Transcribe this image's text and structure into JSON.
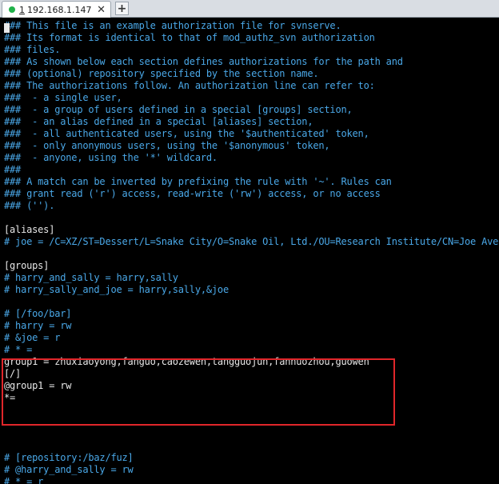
{
  "tab": {
    "index": "1",
    "title": "192.168.1.147",
    "close_glyph": "✕",
    "add_glyph": "+"
  },
  "lines": [
    {
      "kind": "comment",
      "text": "### This file is an example authorization file for svnserve."
    },
    {
      "kind": "comment",
      "text": "### Its format is identical to that of mod_authz_svn authorization"
    },
    {
      "kind": "comment",
      "text": "### files."
    },
    {
      "kind": "comment",
      "text": "### As shown below each section defines authorizations for the path and"
    },
    {
      "kind": "comment",
      "text": "### (optional) repository specified by the section name."
    },
    {
      "kind": "comment",
      "text": "### The authorizations follow. An authorization line can refer to:"
    },
    {
      "kind": "comment",
      "text": "###  - a single user,"
    },
    {
      "kind": "comment",
      "text": "###  - a group of users defined in a special [groups] section,"
    },
    {
      "kind": "comment",
      "text": "###  - an alias defined in a special [aliases] section,"
    },
    {
      "kind": "comment",
      "text": "###  - all authenticated users, using the '$authenticated' token,"
    },
    {
      "kind": "comment",
      "text": "###  - only anonymous users, using the '$anonymous' token,"
    },
    {
      "kind": "comment",
      "text": "###  - anyone, using the '*' wildcard."
    },
    {
      "kind": "comment",
      "text": "###"
    },
    {
      "kind": "comment",
      "text": "### A match can be inverted by prefixing the rule with '~'. Rules can"
    },
    {
      "kind": "comment",
      "text": "### grant read ('r') access, read-write ('rw') access, or no access"
    },
    {
      "kind": "comment",
      "text": "### ('')."
    },
    {
      "kind": "plain",
      "text": ""
    },
    {
      "kind": "plain",
      "text": "[aliases]"
    },
    {
      "kind": "comment",
      "text": "# joe = /C=XZ/ST=Dessert/L=Snake City/O=Snake Oil, Ltd./OU=Research Institute/CN=Joe Ave"
    },
    {
      "kind": "plain",
      "text": ""
    },
    {
      "kind": "plain",
      "text": "[groups]"
    },
    {
      "kind": "comment",
      "text": "# harry_and_sally = harry,sally"
    },
    {
      "kind": "comment",
      "text": "# harry_sally_and_joe = harry,sally,&joe"
    },
    {
      "kind": "plain",
      "text": ""
    },
    {
      "kind": "comment",
      "text": "# [/foo/bar]"
    },
    {
      "kind": "comment",
      "text": "# harry = rw"
    },
    {
      "kind": "comment",
      "text": "# &joe = r"
    },
    {
      "kind": "comment",
      "text": "# * ="
    },
    {
      "kind": "plain",
      "text": "group1 = zhuxiaoyong,fanguo,caozewen,tangguojun,fannuozhou,guowen"
    },
    {
      "kind": "plain",
      "text": "[/]"
    },
    {
      "kind": "plain",
      "text": "@group1 = rw"
    },
    {
      "kind": "plain",
      "text": "*="
    },
    {
      "kind": "plain",
      "text": ""
    },
    {
      "kind": "plain",
      "text": ""
    },
    {
      "kind": "plain",
      "text": ""
    },
    {
      "kind": "plain",
      "text": ""
    },
    {
      "kind": "comment",
      "text": "# [repository:/baz/fuz]"
    },
    {
      "kind": "comment",
      "text": "# @harry_and_sally = rw"
    },
    {
      "kind": "comment",
      "text": "# * = r"
    }
  ],
  "highlight": {
    "color": "#e0262a",
    "first_line": 28,
    "last_line": 31
  },
  "colors": {
    "background": "#000000",
    "comment": "#4aa8e8",
    "text": "#e8e8e8",
    "tab_status": "#21b24a"
  },
  "icons": {
    "tab_status": "green-dot-icon",
    "tab_close": "close-icon",
    "new_tab": "plus-icon"
  }
}
